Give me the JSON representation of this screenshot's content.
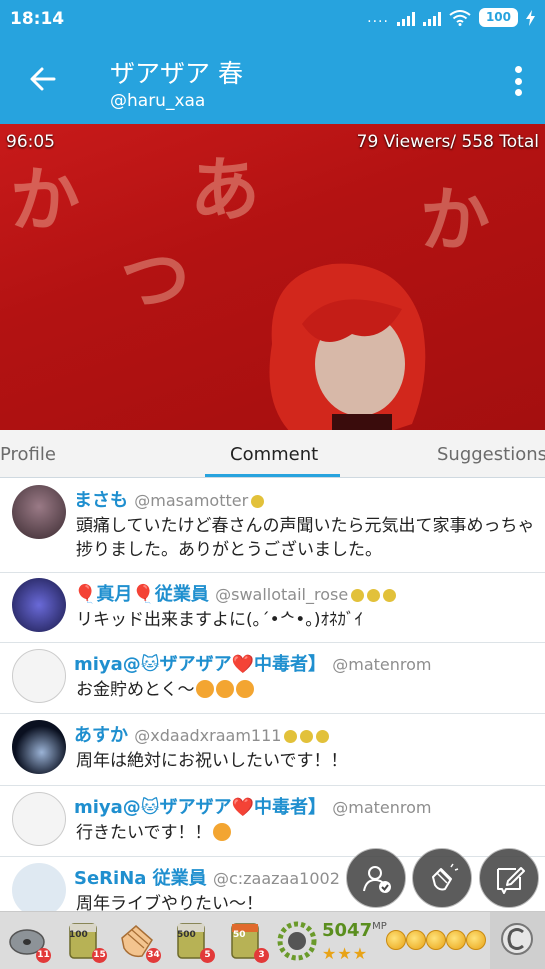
{
  "status_bar": {
    "time": "18:14",
    "battery": "100",
    "signal_dots": "...."
  },
  "header": {
    "title": "ザアザア 春",
    "handle": "@haru_xaa"
  },
  "video": {
    "elapsed": "96:05",
    "viewers": "79 Viewers/ 558 Total"
  },
  "tabs": [
    {
      "label": "Profile"
    },
    {
      "label": "Comment"
    },
    {
      "label": "Suggestions"
    }
  ],
  "active_tab": "Comment",
  "comments": [
    {
      "name": "まさも",
      "user_id": "@masamotter",
      "text": "頭痛していたけど春さんの声聞いたら元気出て家事めっちゃ捗りました。ありがとうございました。"
    },
    {
      "name": "🎈真月🎈従業員",
      "user_id": "@swallotail_rose",
      "text": "リキッド出来ますよに(｡ˊ•ᄉ•｡)ｵﾈｶﾞｲ"
    },
    {
      "name": "miya@🐱ザアザア❤️中毒者】",
      "user_id": "@matenrom",
      "text": "お金貯めとく〜"
    },
    {
      "name": "あすか",
      "user_id": "@xdaadxraam111",
      "text": "周年は絶対にお祝いしたいです！！"
    },
    {
      "name": "miya@🐱ザアザア❤️中毒者】",
      "user_id": "@matenrom",
      "text": "行きたいです！！"
    },
    {
      "name": "SeRiNa 従業員",
      "user_id": "@c:zaazaa1002",
      "text": "周年ライブやりたい〜！"
    }
  ],
  "gift_bar": {
    "items": [
      {
        "name": "disc",
        "count": "11"
      },
      {
        "name": "tea-100",
        "label": "100",
        "count": "15"
      },
      {
        "name": "clapping-hands",
        "count": "34"
      },
      {
        "name": "tea-500",
        "label": "500",
        "count": "5"
      },
      {
        "name": "tea-50",
        "label": "50",
        "count": "3"
      }
    ],
    "mp_value": "5047",
    "mp_unit": "MP",
    "stars": "★★★"
  },
  "colors": {
    "brand": "#27a3de",
    "name_text": "#1f8fcf",
    "video_bg": "#b31212"
  },
  "icons": [
    "back-arrow-icon",
    "more-vert-icon",
    "wifi-icon",
    "battery-icon",
    "follow-user-icon",
    "applause-icon",
    "compose-icon",
    "camera-icon"
  ]
}
